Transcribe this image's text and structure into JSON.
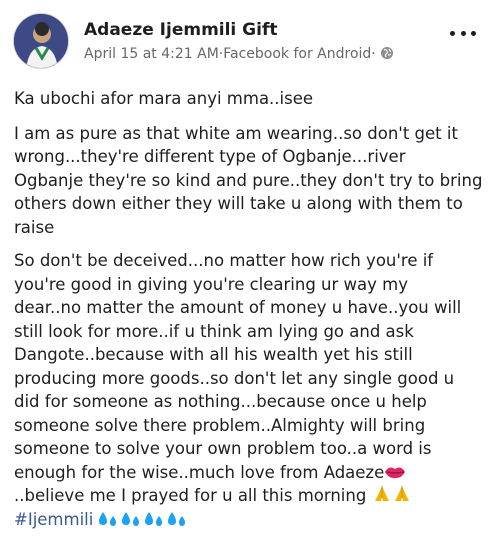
{
  "post": {
    "author": "Adaeze Ijemmili Gift",
    "date": "April 15 at 4:21 AM",
    "separator": " · ",
    "source": "Facebook for Android",
    "separator2": " · ",
    "privacy_icon": "globe-icon",
    "more_icon": "more-options-icon"
  },
  "content": {
    "p1": "Ka ubochi afor mara anyi mma..isee",
    "p2_lines": [
      "I am as pure as that white am wearing..so don't get it",
      "wrong...they're different type of Ogbanje...river",
      "Ogbanje they're so kind and pure..they don't try to bring",
      "others down either they will take u along with them to",
      "raise"
    ],
    "p3_lines": [
      "So don't be deceived...no matter how rich you're if",
      "you're good in giving you're clearing ur way my",
      "dear..no matter the amount of money u have..you will",
      "still look for more..if u think am lying go and ask",
      "Dangote..because with all his wealth yet his still",
      "producing more goods..so don't let any single good u",
      "did for someone as nothing...because once u help",
      "someone solve there problem..Almighty will bring",
      "someone to solve your own problem too..a word is",
      "enough for the wise..much love from Adaeze"
    ],
    "p3_line11": "..believe me I prayed for u all this morning",
    "hashtag": "#Ijemmili",
    "kiss_icon": "kiss-lips-icon",
    "pray_icon": "praying-hands-icon",
    "drops_icon": "sweat-droplets-icon"
  },
  "colors": {
    "link": "#385898",
    "meta": "#65676b",
    "text": "#1c1e21"
  }
}
